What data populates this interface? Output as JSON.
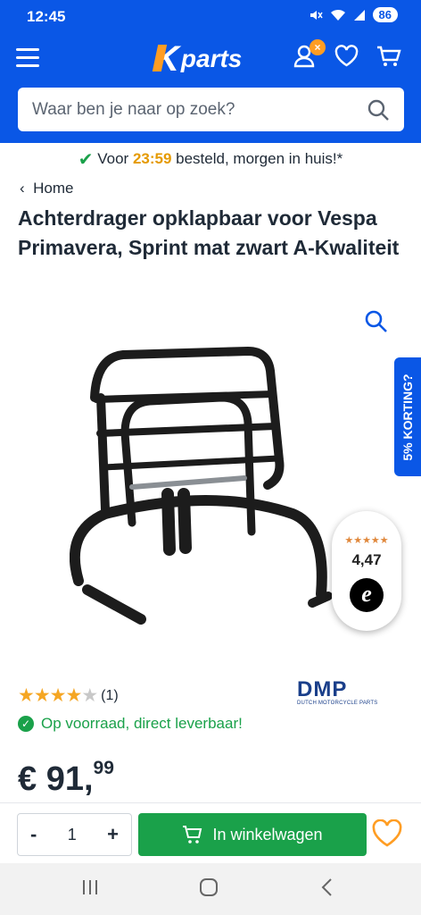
{
  "status": {
    "time": "12:45",
    "battery": "86"
  },
  "header": {
    "logo_k": "K",
    "logo_text": "parts",
    "badge": "×"
  },
  "search": {
    "placeholder": "Waar ben je naar op zoek?"
  },
  "usp": {
    "prefix": "Voor ",
    "time": "23:59",
    "suffix": " besteld, morgen in huis!*"
  },
  "breadcrumb": {
    "label": "Home"
  },
  "product": {
    "title": "Achterdrager opklapbaar voor Vespa Primavera, Sprint mat zwart A-Kwaliteit",
    "rating_count": "(1)",
    "rating_value": 4,
    "brand": "DMP",
    "brand_sub": "DUTCH MOTORCYCLE PARTS",
    "stock": "Op voorraad, direct leverbaar!",
    "price_main": "€ 91,",
    "price_cents": "99"
  },
  "promo": {
    "label": "5% KORTING?"
  },
  "trusted": {
    "stars": "★★★★★",
    "score": "4,47",
    "logo": "e"
  },
  "cart": {
    "qty": "1",
    "minus": "-",
    "plus": "+",
    "button": "In winkelwagen"
  },
  "colors": {
    "brand_blue": "#0a57e6",
    "accent_orange": "#ff9d23",
    "green": "#1aa14a"
  }
}
